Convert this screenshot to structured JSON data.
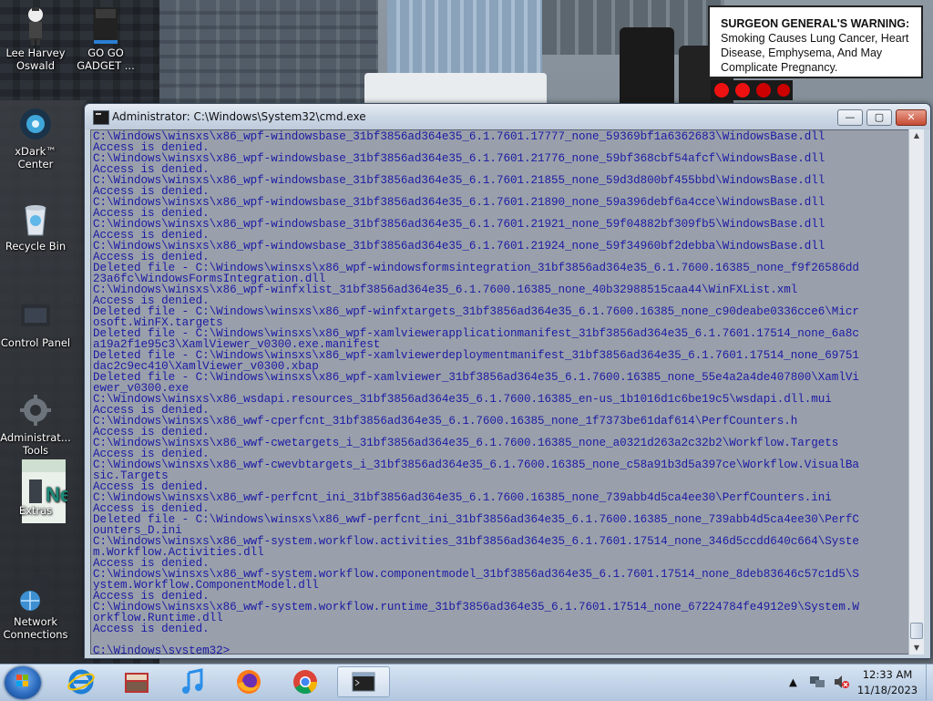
{
  "desktop": {
    "warning_sign": {
      "lead": "SURGEON GENERAL'S WARNING:",
      "body": " Smoking Causes Lung Cancer, Heart Disease, Emphysema, And May Complicate Pregnancy."
    },
    "icons": [
      {
        "label": "Lee Harvey Oswald",
        "icon": "person-figure-icon"
      },
      {
        "label": "GO GO GADGET ...",
        "icon": "gadget-box-icon"
      },
      {
        "label": "xDark™ Center",
        "icon": "xdark-center-icon"
      },
      {
        "label": "Recycle Bin",
        "icon": "recycle-bin-icon"
      },
      {
        "label": "Control Panel",
        "icon": "control-panel-icon"
      },
      {
        "label": "Administrat... Tools",
        "icon": "admin-tools-icon"
      },
      {
        "label": "Extras",
        "icon": "extras-box-icon"
      },
      {
        "label": "Network Connections",
        "icon": "network-connections-icon"
      }
    ]
  },
  "window": {
    "title": "Administrator: C:\\Windows\\System32\\cmd.exe",
    "buttons": {
      "minimize": "—",
      "maximize": "▢",
      "close": "✕"
    },
    "console_lines": [
      "C:\\Windows\\winsxs\\x86_wpf-windowsbase_31bf3856ad364e35_6.1.7601.17777_none_59369bf1a6362683\\WindowsBase.dll",
      "Access is denied.",
      "C:\\Windows\\winsxs\\x86_wpf-windowsbase_31bf3856ad364e35_6.1.7601.21776_none_59bf368cbf54afcf\\WindowsBase.dll",
      "Access is denied.",
      "C:\\Windows\\winsxs\\x86_wpf-windowsbase_31bf3856ad364e35_6.1.7601.21855_none_59d3d800bf455bbd\\WindowsBase.dll",
      "Access is denied.",
      "C:\\Windows\\winsxs\\x86_wpf-windowsbase_31bf3856ad364e35_6.1.7601.21890_none_59a396debf6a4cce\\WindowsBase.dll",
      "Access is denied.",
      "C:\\Windows\\winsxs\\x86_wpf-windowsbase_31bf3856ad364e35_6.1.7601.21921_none_59f04882bf309fb5\\WindowsBase.dll",
      "Access is denied.",
      "C:\\Windows\\winsxs\\x86_wpf-windowsbase_31bf3856ad364e35_6.1.7601.21924_none_59f34960bf2debba\\WindowsBase.dll",
      "Access is denied.",
      "Deleted file - C:\\Windows\\winsxs\\x86_wpf-windowsformsintegration_31bf3856ad364e35_6.1.7600.16385_none_f9f26586dd",
      "23a6fc\\WindowsFormsIntegration.dll",
      "C:\\Windows\\winsxs\\x86_wpf-winfxlist_31bf3856ad364e35_6.1.7600.16385_none_40b32988515caa44\\WinFXList.xml",
      "Access is denied.",
      "Deleted file - C:\\Windows\\winsxs\\x86_wpf-winfxtargets_31bf3856ad364e35_6.1.7600.16385_none_c90deabe0336cce6\\Micr",
      "osoft.WinFX.targets",
      "Deleted file - C:\\Windows\\winsxs\\x86_wpf-xamlviewerapplicationmanifest_31bf3856ad364e35_6.1.7601.17514_none_6a8c",
      "a19a2f1e95c3\\XamlViewer_v0300.exe.manifest",
      "Deleted file - C:\\Windows\\winsxs\\x86_wpf-xamlviewerdeploymentmanifest_31bf3856ad364e35_6.1.7601.17514_none_69751",
      "dac2c9ec410\\XamlViewer_v0300.xbap",
      "Deleted file - C:\\Windows\\winsxs\\x86_wpf-xamlviewer_31bf3856ad364e35_6.1.7600.16385_none_55e4a2a4de407800\\XamlVi",
      "ewer_v0300.exe",
      "C:\\Windows\\winsxs\\x86_wsdapi.resources_31bf3856ad364e35_6.1.7600.16385_en-us_1b1016d1c6be19c5\\wsdapi.dll.mui",
      "Access is denied.",
      "C:\\Windows\\winsxs\\x86_wwf-cperfcnt_31bf3856ad364e35_6.1.7600.16385_none_1f7373be61daf614\\PerfCounters.h",
      "Access is denied.",
      "C:\\Windows\\winsxs\\x86_wwf-cwetargets_i_31bf3856ad364e35_6.1.7600.16385_none_a0321d263a2c32b2\\Workflow.Targets",
      "Access is denied.",
      "C:\\Windows\\winsxs\\x86_wwf-cwevbtargets_i_31bf3856ad364e35_6.1.7600.16385_none_c58a91b3d5a397ce\\Workflow.VisualBa",
      "sic.Targets",
      "Access is denied.",
      "C:\\Windows\\winsxs\\x86_wwf-perfcnt_ini_31bf3856ad364e35_6.1.7600.16385_none_739abb4d5ca4ee30\\PerfCounters.ini",
      "Access is denied.",
      "Deleted file - C:\\Windows\\winsxs\\x86_wwf-perfcnt_ini_31bf3856ad364e35_6.1.7600.16385_none_739abb4d5ca4ee30\\PerfC",
      "ounters_D.ini",
      "C:\\Windows\\winsxs\\x86_wwf-system.workflow.activities_31bf3856ad364e35_6.1.7601.17514_none_346d5ccdd640c664\\Syste",
      "m.Workflow.Activities.dll",
      "Access is denied.",
      "C:\\Windows\\winsxs\\x86_wwf-system.workflow.componentmodel_31bf3856ad364e35_6.1.7601.17514_none_8deb83646c57c1d5\\S",
      "ystem.Workflow.ComponentModel.dll",
      "Access is denied.",
      "C:\\Windows\\winsxs\\x86_wwf-system.workflow.runtime_31bf3856ad364e35_6.1.7601.17514_none_67224784fe4912e9\\System.W",
      "orkflow.Runtime.dll",
      "Access is denied.",
      "",
      "C:\\Windows\\system32>"
    ]
  },
  "taskbar": {
    "start_icon": "windows-start-orb-icon",
    "pinned": [
      {
        "icon": "internet-explorer-icon"
      },
      {
        "icon": "media-center-icon"
      },
      {
        "icon": "itunes-music-note-icon"
      },
      {
        "icon": "firefox-icon"
      },
      {
        "icon": "chrome-icon"
      },
      {
        "icon": "cmd-window-icon",
        "active": true
      }
    ],
    "tray": {
      "time": "12:33 AM",
      "date": "11/18/2023"
    }
  },
  "colors": {
    "console_bg": "#9aa0ab",
    "console_text": "#1a1aa3",
    "taskbar": "#c3d5e9"
  }
}
